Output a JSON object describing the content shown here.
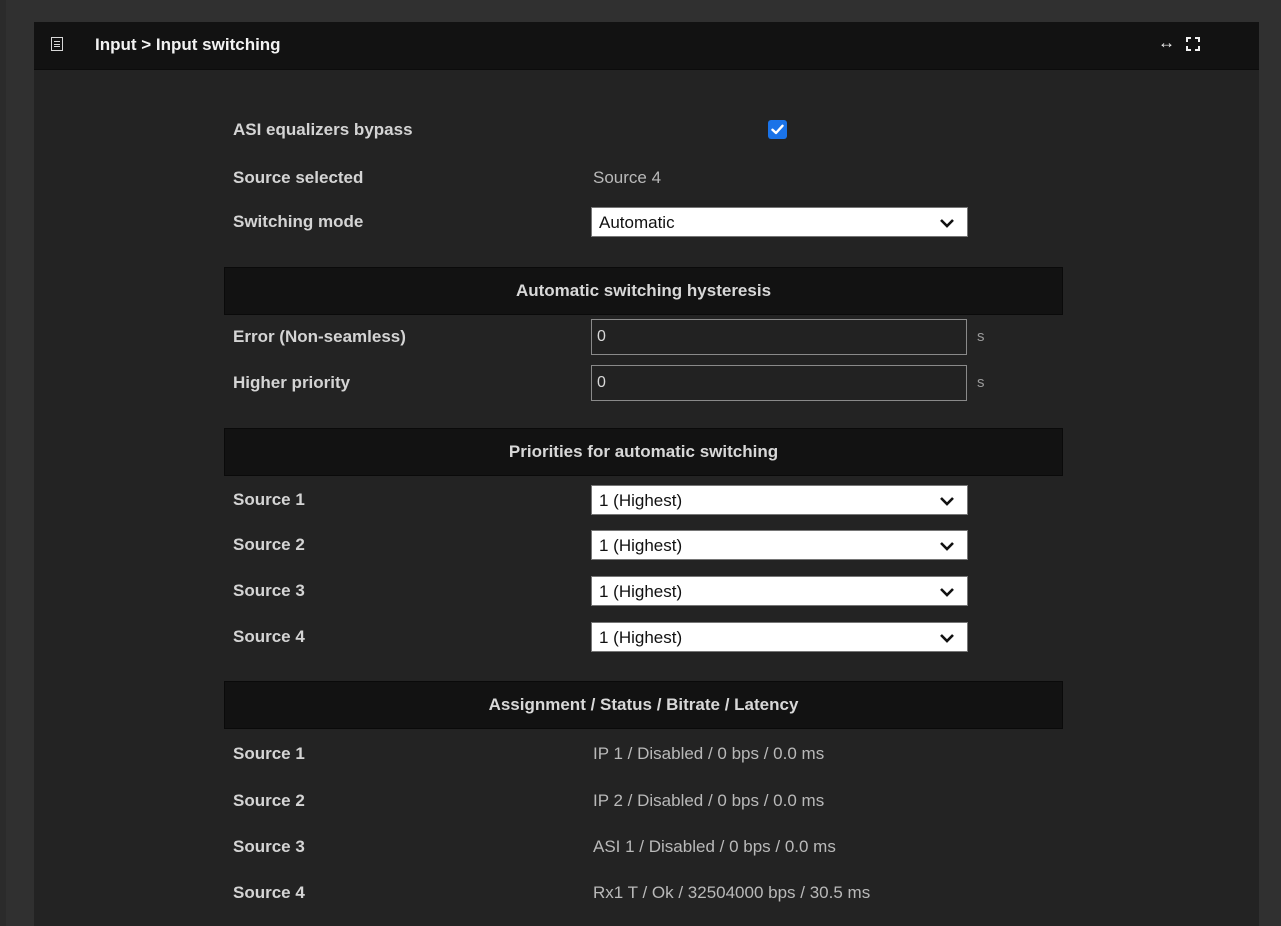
{
  "header": {
    "title": "Input > Input switching",
    "menu_icon": "list-icon",
    "expand_icon": "↔",
    "fullscreen_icon": "fullscreen-icon"
  },
  "general": {
    "asi_bypass_label": "ASI equalizers bypass",
    "asi_bypass_checked": true,
    "source_selected_label": "Source selected",
    "source_selected_value": "Source 4",
    "switching_mode_label": "Switching mode",
    "switching_mode_value": "Automatic"
  },
  "hysteresis": {
    "title": "Automatic switching hysteresis",
    "error_label": "Error (Non-seamless)",
    "error_value": "0",
    "error_unit": "s",
    "priority_label": "Higher priority",
    "priority_value": "0",
    "priority_unit": "s"
  },
  "priorities": {
    "title": "Priorities for automatic switching",
    "items": [
      {
        "label": "Source 1",
        "value": "1 (Highest)"
      },
      {
        "label": "Source 2",
        "value": "1 (Highest)"
      },
      {
        "label": "Source 3",
        "value": "1 (Highest)"
      },
      {
        "label": "Source 4",
        "value": "1 (Highest)"
      }
    ]
  },
  "status": {
    "title": "Assignment / Status / Bitrate / Latency",
    "items": [
      {
        "label": "Source 1",
        "value": "IP 1 / Disabled / 0 bps / 0.0 ms"
      },
      {
        "label": "Source 2",
        "value": "IP 2 / Disabled / 0 bps / 0.0 ms"
      },
      {
        "label": "Source 3",
        "value": "ASI 1 / Disabled / 0 bps / 0.0 ms"
      },
      {
        "label": "Source 4",
        "value": "Rx1 T / Ok / 32504000 bps / 30.5 ms"
      }
    ]
  },
  "colors": {
    "panel_bg": "#232323",
    "header_bg": "#121212",
    "checkbox_accent": "#1a73e8"
  }
}
